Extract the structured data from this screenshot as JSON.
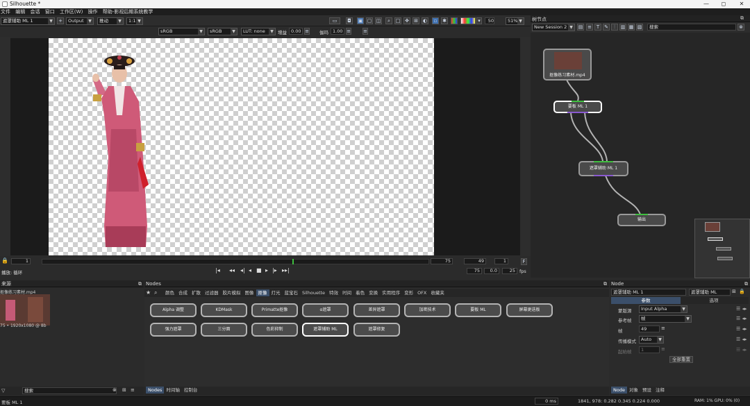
{
  "window": {
    "title": "Silhouette *",
    "minimize": "—",
    "maximize": "◻",
    "close": "✕"
  },
  "menu": [
    "文件",
    "编辑",
    "会话",
    "窗口",
    "工作区(W)",
    "操作",
    "帮助-影视后期系统教学"
  ],
  "toolbar": {
    "node_select": "遮罩辅助 ML 1",
    "output_select": "Output",
    "track_select": "推动",
    "ratio_select": "1:1",
    "zoom_field": "50",
    "zoom_pct": "51%"
  },
  "options": {
    "cs1": "sRGB",
    "cs2": "sRGB",
    "lut": "LUT: none",
    "gain_label": "增益",
    "gain_value": "0.00",
    "gamma_label": "伽玛",
    "gamma_value": "1.00"
  },
  "timeline": {
    "start": "1",
    "end": "75",
    "current": "49",
    "step": "1",
    "f_label": "F",
    "out_frame": "75",
    "speed": "0.0",
    "fps_value": "25",
    "fps_label": "fps",
    "playback_label": "播放: 循环"
  },
  "tree": {
    "title": "树节点",
    "session": "New Session 2",
    "search_placeholder": "搜索",
    "nodes": {
      "source": "抠像练习素材.mp4",
      "roto": "要板 ML 1",
      "matte": "遮罩辅助 ML 1",
      "output": "输出"
    }
  },
  "sources": {
    "title": "来源",
    "clip_name": "抠像练习素材.mp4",
    "clip_info": "75 • 1920x1080 @ 8b",
    "search_placeholder": "搜索"
  },
  "nodes_panel": {
    "title": "Nodes",
    "tabs": [
      "颜色",
      "合成",
      "扩散",
      "过滤器",
      "胶片模拟",
      "图像",
      "抠像",
      "灯光",
      "蓝宝石",
      "Silhouette",
      "特效",
      "时间",
      "着色",
      "变换",
      "实用程序",
      "变形",
      "OFX",
      "收藏夹"
    ],
    "active_tab": "抠像",
    "buttons": [
      "Alpha 调整",
      "KDMask",
      "Primatte抠像",
      "α遮罩",
      "差异遮罩",
      "加密技术",
      "要板 ML",
      "屏幕更迭板",
      "强力遮罩",
      "三分面",
      "色彩抑制",
      "遮罩辅助 ML",
      "遮罩修复"
    ],
    "bottom_tabs": [
      "Nodes",
      "时间轴",
      "控制台"
    ]
  },
  "node_props": {
    "title": "Node",
    "name_value": "遮罩辅助 ML 1",
    "type_value": "遮罩辅助 ML",
    "tabs": [
      "参数",
      "选项"
    ],
    "rows": [
      {
        "label": "蒙版源",
        "value": "Input Alpha"
      },
      {
        "label": "参考帧",
        "value": "帧"
      },
      {
        "label": "帧",
        "value": "49"
      },
      {
        "label": "传播模式",
        "value": "Auto"
      },
      {
        "label": "起始帧",
        "value": "1"
      }
    ],
    "reset_button": "全部重置",
    "bottom_tabs": [
      "Node",
      "对象",
      "预设",
      "注释"
    ]
  },
  "status": {
    "left": "要板 ML 1",
    "ms": "0 ms",
    "coords": "1841,  978: 0.282 0.345 0.224 0.000",
    "ram": "RAM: 1% GPU: 0% (0)"
  },
  "colors": {
    "accent": "#3d6fb0",
    "link": "#b3b3b3",
    "green": "#3fbf3f",
    "purple": "#8a5ad1"
  }
}
